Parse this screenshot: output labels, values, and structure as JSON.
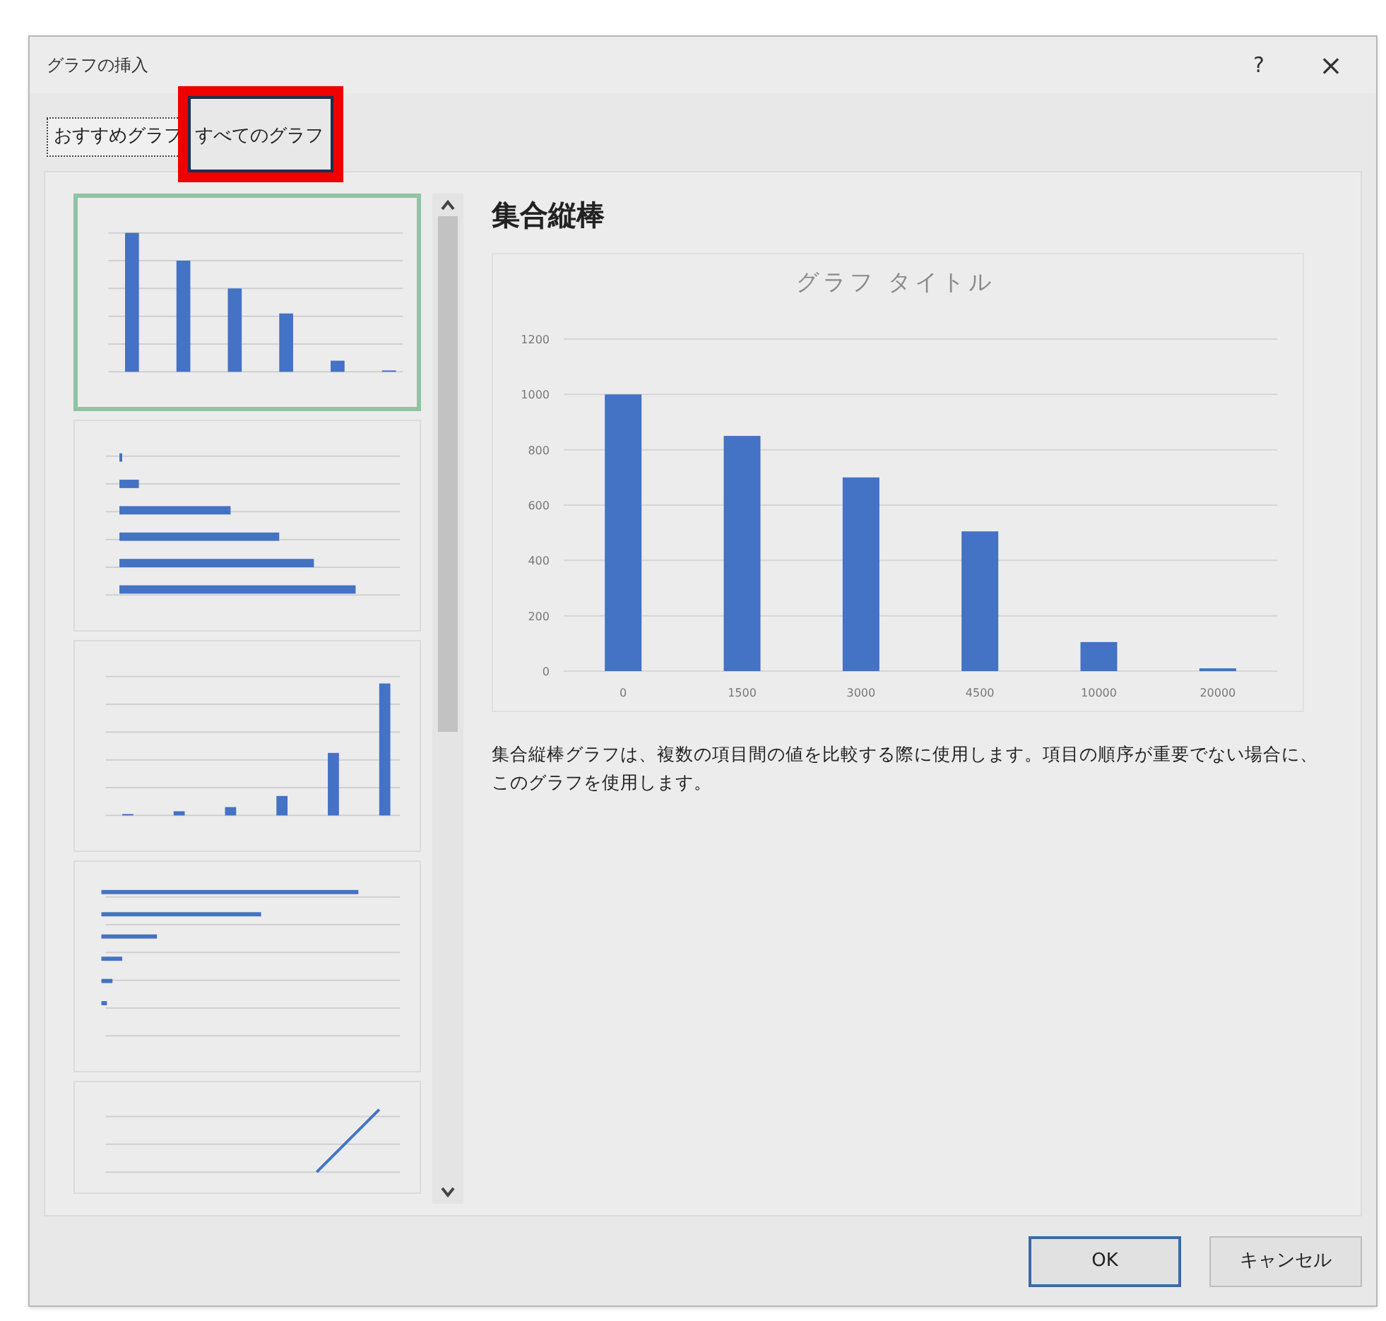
{
  "window": {
    "title": "グラフの挿入",
    "help": "?",
    "close": "×"
  },
  "tabs": [
    {
      "label": "おすすめグラフ",
      "selected": true,
      "highlighted": false
    },
    {
      "label": "すべてのグラフ",
      "selected": false,
      "highlighted": true
    }
  ],
  "thumbnails": [
    {
      "kind": "column",
      "selected": true
    },
    {
      "kind": "bar",
      "selected": false
    },
    {
      "kind": "column-rising",
      "selected": false
    },
    {
      "kind": "bar-thin",
      "selected": false
    },
    {
      "kind": "line",
      "selected": false
    }
  ],
  "preview": {
    "heading": "集合縦棒",
    "chart_data": {
      "type": "bar",
      "title": "グラフ タイトル",
      "categories": [
        "0",
        "1500",
        "3000",
        "4500",
        "10000",
        "20000"
      ],
      "series": [
        {
          "color": "#4472c4",
          "values": [
            1000,
            850,
            700,
            505,
            105,
            10
          ]
        }
      ],
      "grid": true,
      "ylim": [
        0,
        1200
      ],
      "yticks": [
        0,
        200,
        400,
        600,
        800,
        1000,
        1200
      ]
    },
    "description": "集合縦棒グラフは、複数の項目間の値を比較する際に使用します。項目の順序が重要でない場合に、このグラフを使用します。"
  },
  "buttons": [
    {
      "label": "OK",
      "default": true
    },
    {
      "label": "キャンセル",
      "default": false
    }
  ]
}
